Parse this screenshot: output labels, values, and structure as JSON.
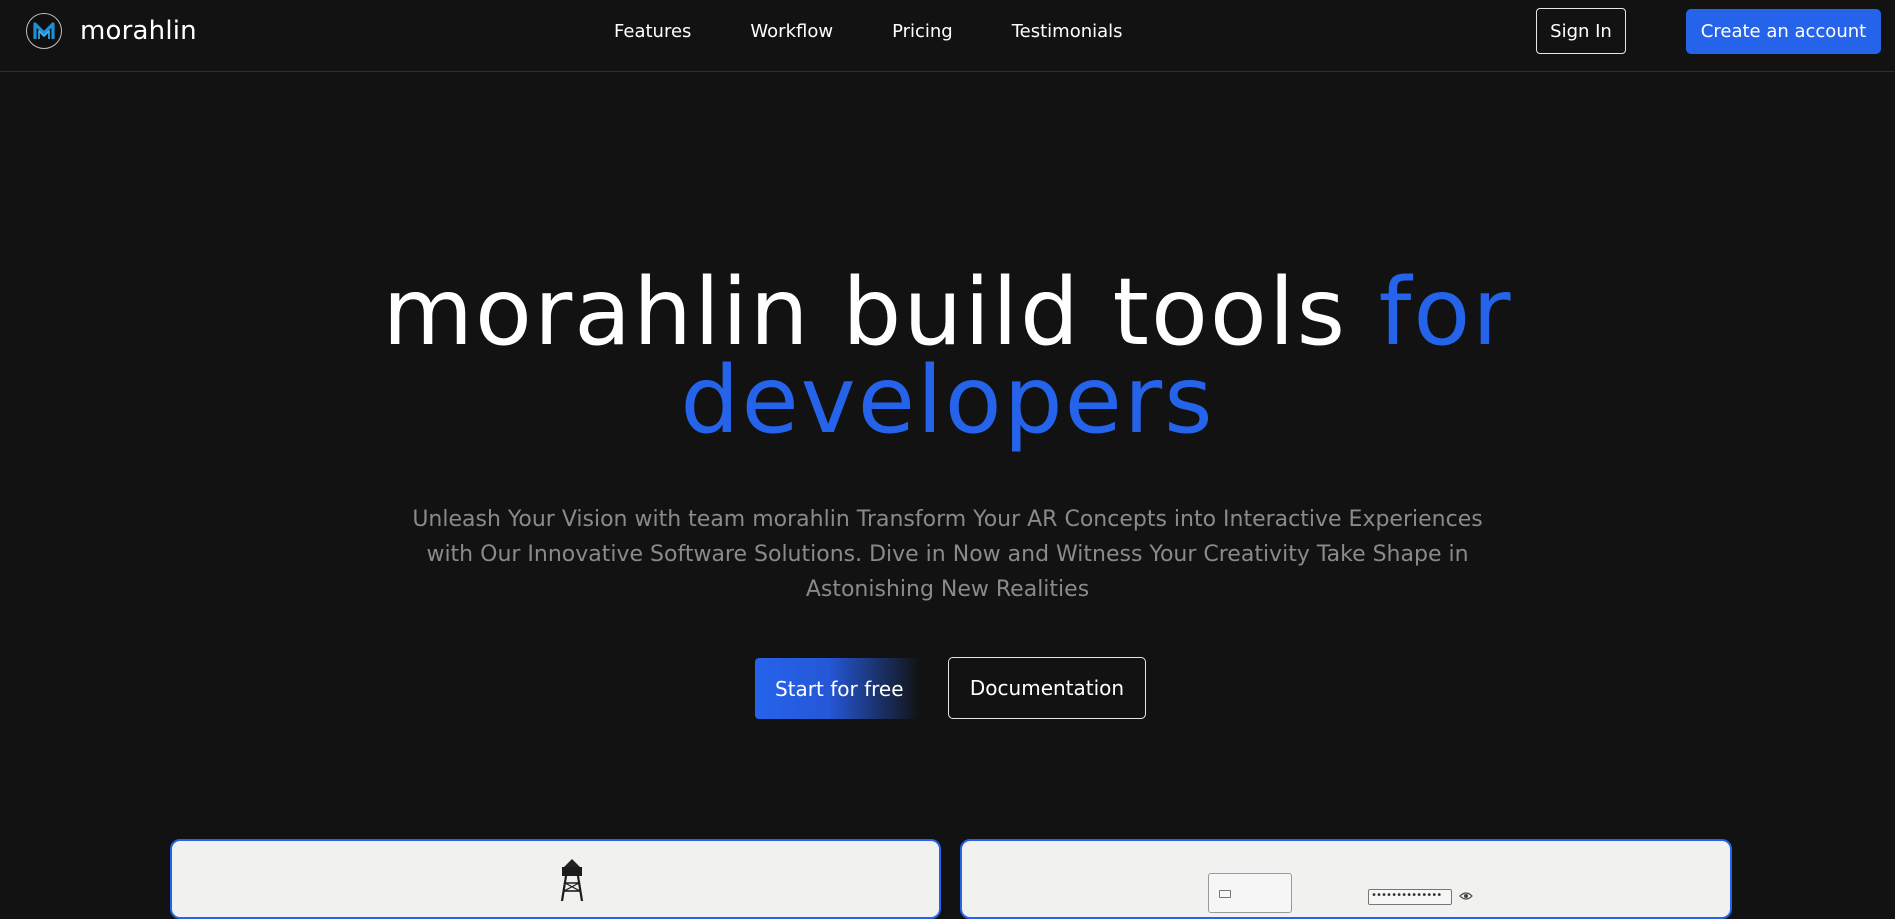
{
  "header": {
    "brand_name": "morahlin",
    "logo_letter": "M",
    "nav_links": [
      "Features",
      "Workflow",
      "Pricing",
      "Testimonials"
    ],
    "sign_in_label": "Sign In",
    "create_account_label": "Create an account"
  },
  "hero": {
    "title_part1": "morahlin build tools ",
    "title_accent1": "for",
    "title_accent2": "developers",
    "subtitle": "Unleash Your Vision with team morahlin Transform Your AR Concepts into Interactive Experiences with Our Innovative Software Solutions. Dive in Now and Witness Your Creativity Take Shape in Astonishing New Realities",
    "primary_cta": "Start for free",
    "secondary_cta": "Documentation"
  },
  "preview": {
    "password_mask": "••••••••••••••"
  },
  "colors": {
    "accent": "#2563eb",
    "background": "#121212",
    "muted_text": "#8a8a8a",
    "card_bg": "#f1f1f0"
  },
  "icons": {
    "logo": "morahlin-logo-icon",
    "tower": "tower-icon",
    "eye": "eye-icon"
  }
}
